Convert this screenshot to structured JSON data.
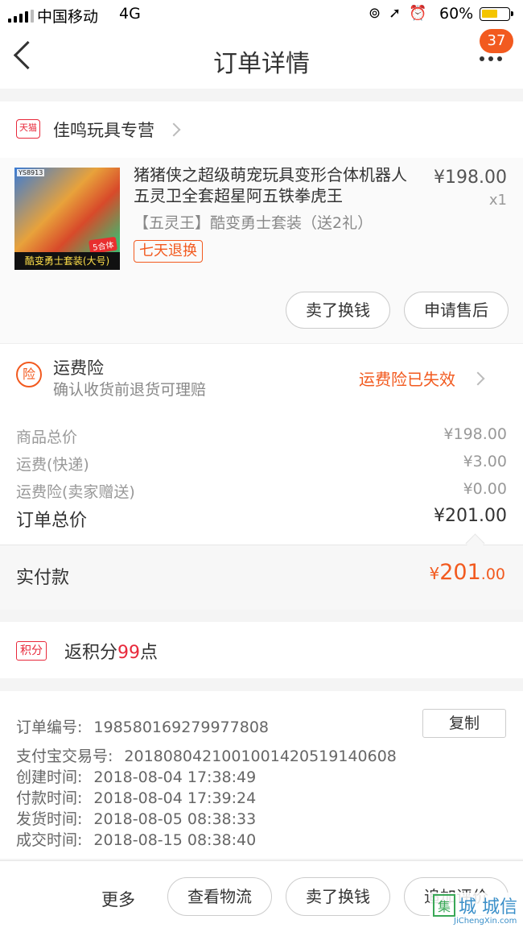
{
  "status_bar": {
    "carrier": "中国移动",
    "network": "4G",
    "battery": "60%",
    "battery_level": 0.6
  },
  "nav": {
    "title": "订单详情",
    "badge": "37"
  },
  "store": {
    "badge": "天猫",
    "name": "佳鸣玩具专营"
  },
  "product": {
    "image_code": "YS8913",
    "image_tag": "5合体",
    "image_caption": "酷变勇士套装(大号)",
    "title": "猪猪侠之超级萌宠玩具变形合体机器人五灵卫全套超星阿五铁拳虎王",
    "sku": "【五灵王】酷变勇士套装（送2礼）",
    "tag": "七天退换",
    "price": "¥198.00",
    "qty": "x1",
    "actions": [
      "卖了换钱",
      "申请售后"
    ]
  },
  "insurance": {
    "icon": "险",
    "title": "运费险",
    "subtitle": "确认收货前退货可理赔",
    "status": "运费险已失效"
  },
  "costs": {
    "rows": [
      {
        "label": "商品总价",
        "value": "¥198.00"
      },
      {
        "label": "运费(快递)",
        "value": "¥3.00"
      },
      {
        "label": "运费险(卖家赠送)",
        "value": "¥0.00"
      }
    ],
    "total_label": "订单总价",
    "total_value": "¥201.00"
  },
  "paid": {
    "label": "实付款",
    "currency": "¥",
    "integer": "201",
    "decimal": ".00"
  },
  "points": {
    "tag": "积分",
    "prefix": "返积分",
    "count": "99",
    "suffix": "点"
  },
  "order_info": {
    "copy_label": "复制",
    "rows": [
      {
        "label": "订单编号:",
        "value": "198580169279977808"
      },
      {
        "label": "支付宝交易号:",
        "value": "2018080421001001420519140608"
      },
      {
        "label": "创建时间:",
        "value": "2018-08-04 17:38:49"
      },
      {
        "label": "付款时间:",
        "value": "2018-08-04 17:39:24"
      },
      {
        "label": "发货时间:",
        "value": "2018-08-05 08:38:33"
      },
      {
        "label": "成交时间:",
        "value": "2018-08-15 08:38:40"
      }
    ]
  },
  "bottom_bar": {
    "more": "更多",
    "buttons": [
      "查看物流",
      "卖了换钱",
      "追加评价"
    ]
  },
  "watermark": {
    "logo": "集",
    "cn": "城 城信",
    "en": "JiChengXin.com"
  },
  "colors": {
    "accent": "#f25a1f",
    "tmall_red": "#e8293b"
  }
}
